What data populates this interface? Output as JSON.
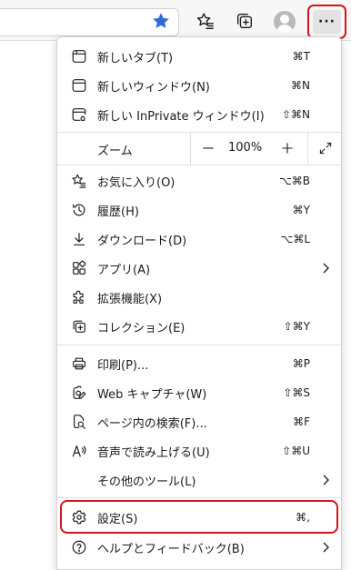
{
  "toolbar": {
    "icons": [
      "favorites-star-icon",
      "favorites-list-icon",
      "collections-icon",
      "profile-avatar",
      "settings-and-more-icon"
    ],
    "more_label": "···",
    "accent": "#2b6cd4",
    "highlight": "#d6141d"
  },
  "menu": {
    "group1": [
      {
        "label": "新しいタブ(T)",
        "shortcut": "⌘T",
        "icon": "new-tab-icon"
      },
      {
        "label": "新しいウィンドウ(N)",
        "shortcut": "⌘N",
        "icon": "new-window-icon"
      },
      {
        "label": "新しい InPrivate ウィンドウ(I)",
        "shortcut": "⇧⌘N",
        "icon": "inprivate-window-icon"
      }
    ],
    "zoom": {
      "label": "ズーム",
      "minus": "—",
      "value": "100%",
      "plus": "+",
      "icon": "fullscreen-icon"
    },
    "group2": [
      {
        "label": "お気に入り(O)",
        "shortcut": "⌥⌘B",
        "icon": "favorites-icon"
      },
      {
        "label": "履歴(H)",
        "shortcut": "⌘Y",
        "icon": "history-icon"
      },
      {
        "label": "ダウンロード(D)",
        "shortcut": "⌥⌘L",
        "icon": "download-icon"
      },
      {
        "label": "アプリ(A)",
        "shortcut": "",
        "icon": "apps-icon",
        "submenu": true
      },
      {
        "label": "拡張機能(X)",
        "shortcut": "",
        "icon": "extensions-icon"
      },
      {
        "label": "コレクション(E)",
        "shortcut": "⇧⌘Y",
        "icon": "collections-icon"
      }
    ],
    "group3": [
      {
        "label": "印刷(P)...",
        "shortcut": "⌘P",
        "icon": "print-icon"
      },
      {
        "label": "Web キャプチャ(W)",
        "shortcut": "⇧⌘S",
        "icon": "web-capture-icon"
      },
      {
        "label": "ページ内の検索(F)...",
        "shortcut": "⌘F",
        "icon": "find-on-page-icon"
      },
      {
        "label": "音声で読み上げる(U)",
        "shortcut": "⇧⌘U",
        "icon": "read-aloud-icon"
      },
      {
        "label": "その他のツール(L)",
        "shortcut": "",
        "icon": "",
        "submenu": true
      }
    ],
    "group4": [
      {
        "label": "設定(S)",
        "shortcut": "⌘,",
        "icon": "settings-gear-icon"
      },
      {
        "label": "ヘルプとフィードバック(B)",
        "shortcut": "",
        "icon": "help-icon",
        "submenu": true
      }
    ]
  }
}
